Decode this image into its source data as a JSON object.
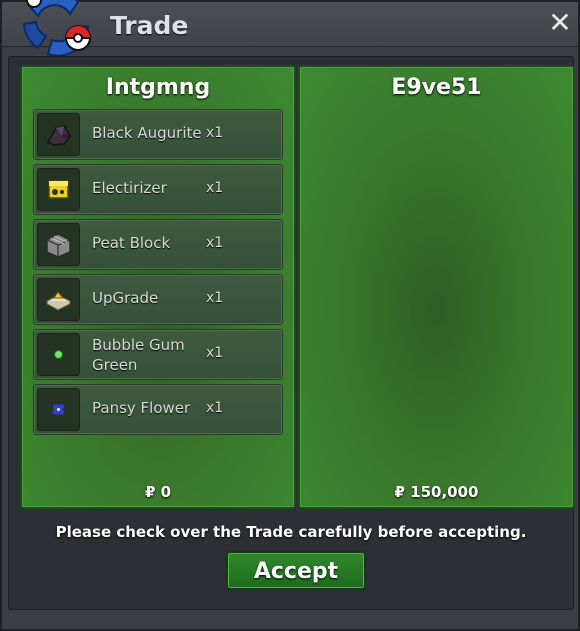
{
  "window": {
    "title": "Trade",
    "close_icon": "close-icon"
  },
  "left_player": {
    "name": "Intgmng",
    "currency_symbol": "₽",
    "money": "0",
    "items": [
      {
        "name": "Black Augurite",
        "qty": "x1",
        "icon": "black-augurite-icon"
      },
      {
        "name": "Electirizer",
        "qty": "x1",
        "icon": "electirizer-icon"
      },
      {
        "name": "Peat Block",
        "qty": "x1",
        "icon": "peat-block-icon"
      },
      {
        "name": "UpGrade",
        "qty": "x1",
        "icon": "upgrade-icon"
      },
      {
        "name": "Bubble Gum Green",
        "qty": "x1",
        "icon": "bubble-gum-green-icon"
      },
      {
        "name": "Pansy Flower",
        "qty": "x1",
        "icon": "pansy-flower-icon"
      }
    ]
  },
  "right_player": {
    "name": "E9ve51",
    "currency_symbol": "₽",
    "money": "150,000",
    "items": []
  },
  "message": "Please check over the Trade carefully before accepting.",
  "accept_label": "Accept"
}
